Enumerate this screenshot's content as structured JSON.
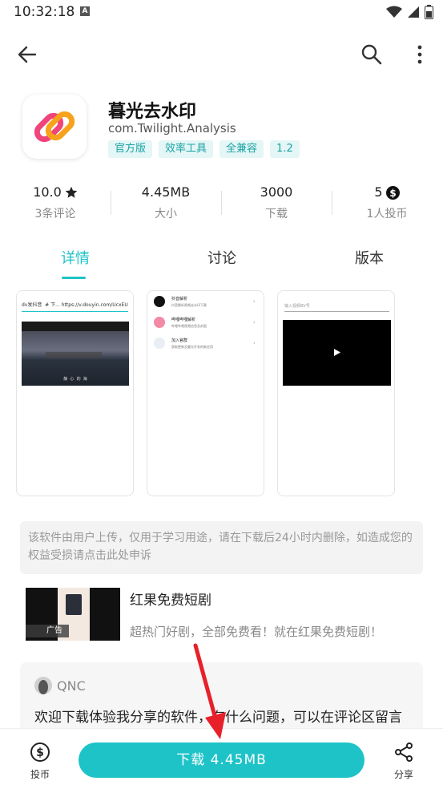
{
  "status_bar": {
    "time": "10:32:18",
    "notification_glyph": "A",
    "icons": [
      "wifi-icon",
      "signal-icon",
      "battery-icon"
    ]
  },
  "toolbar": {
    "back": "back-arrow-icon",
    "search": "search-icon",
    "more": "more-vertical-icon"
  },
  "app": {
    "name": "暮光去水印",
    "package": "com.Twilight.Analysis",
    "tags": [
      "官方版",
      "效率工具",
      "全兼容",
      "1.2"
    ],
    "icon_colors": {
      "pink": "#f0457a",
      "orange": "#f7a21a"
    }
  },
  "stats": [
    {
      "value": "10.0",
      "icon": "star-icon",
      "label": "3条评论"
    },
    {
      "value": "4.45MB",
      "icon": "",
      "label": "大小"
    },
    {
      "value": "3000",
      "icon": "",
      "label": "下载"
    },
    {
      "value": "5",
      "icon": "dollar-coin-icon",
      "label": "1人投币"
    }
  ],
  "tabs": [
    {
      "label": "详情",
      "active": true
    },
    {
      "label": "讨论",
      "active": false
    },
    {
      "label": "版本",
      "active": false
    }
  ],
  "screenshots": {
    "shot1": {
      "url_bar": "dv发抖音  # 下... https://v.douyin.com/UcxEUHoi/",
      "caption": "静  心  的  海"
    },
    "shot2": {
      "items": [
        {
          "title": "抖音解析",
          "desc": "抖音解析视频去水印下载"
        },
        {
          "title": "哔哩哔哩解析",
          "desc": "哔哩哔哩视频信息及封面"
        },
        {
          "title": "加入官群",
          "desc": "获取更新及暮光开发的新应用"
        }
      ]
    },
    "shot3": {
      "input_placeholder": "输入视频BV号"
    }
  },
  "notice": "该软件由用户上传，仅用于学习用途，请在下载后24小时内删除，如造成您的权益受损请点击此处申诉",
  "ad": {
    "badge": "广告",
    "title": "红果免费短剧",
    "desc": "超热门好剧，全部免费看！就在红果免费短剧！"
  },
  "comment": {
    "user": "QNC",
    "text": "欢迎下载体验我分享的软件，有什么问题，可以在评论区留言"
  },
  "bottom": {
    "coin_label": "投币",
    "download_label": "下载 4.45MB",
    "share_label": "分享"
  },
  "colors": {
    "accent": "#1ec3c8",
    "tag_bg": "#e4f6f6",
    "tag_text": "#1aa3a3",
    "annotation_arrow": "#e8202a"
  }
}
